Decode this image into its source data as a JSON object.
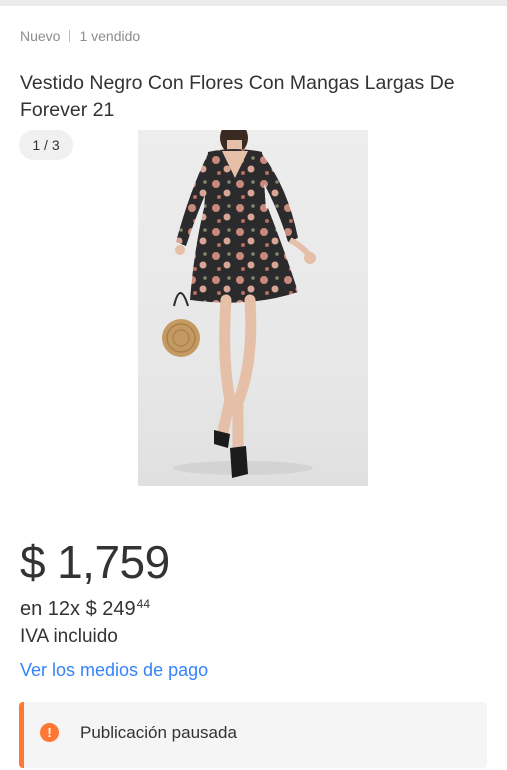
{
  "listing": {
    "condition": "Nuevo",
    "sold": "1 vendido",
    "title": "Vestido Negro Con Flores Con Mangas Largas De Forever 21"
  },
  "gallery": {
    "counter": "1 / 3",
    "image": "woman-in-black-floral-long-sleeve-dress-with-round-rattan-bag"
  },
  "pricing": {
    "currency": "$",
    "amount": "1,759",
    "installments_prefix": "en 12x $ 249",
    "installments_cents": "44",
    "tax_note": "IVA incluido",
    "payment_link": "Ver los medios de pago"
  },
  "status": {
    "icon": "alert-icon",
    "icon_glyph": "!",
    "message": "Publicación pausada",
    "accent_color": "#ff7733"
  },
  "colors": {
    "link": "#3483fa",
    "text": "#333333",
    "muted": "#8c8c8c"
  }
}
